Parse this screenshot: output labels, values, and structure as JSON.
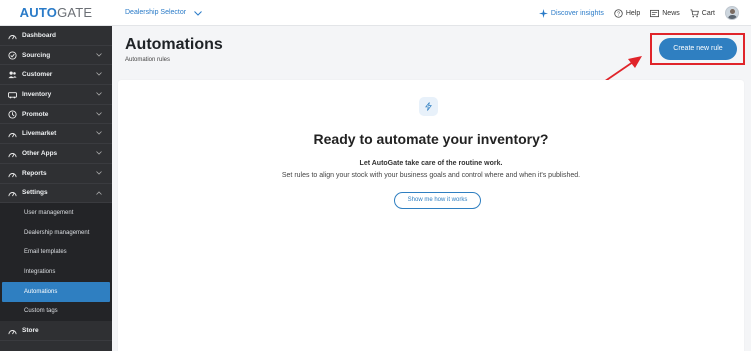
{
  "app": {
    "logo_primary": "AUTO",
    "logo_secondary": "GATE",
    "dealer_selector": "Dealership Selector"
  },
  "topnav": {
    "discover": "Discover insights",
    "help": "Help",
    "news": "News",
    "cart": "Cart"
  },
  "sidebar": {
    "items": [
      {
        "label": "Dashboard",
        "icon": "dashboard-icon"
      },
      {
        "label": "Sourcing",
        "icon": "sourcing-icon"
      },
      {
        "label": "Customer",
        "icon": "customer-icon"
      },
      {
        "label": "Inventory",
        "icon": "inventory-icon"
      },
      {
        "label": "Promote",
        "icon": "promote-icon"
      },
      {
        "label": "Livemarket",
        "icon": "livemarket-icon"
      },
      {
        "label": "Other Apps",
        "icon": "apps-icon"
      },
      {
        "label": "Reports",
        "icon": "reports-icon"
      },
      {
        "label": "Settings",
        "icon": "settings-icon"
      }
    ],
    "settings_sub": [
      "User management",
      "Dealership management",
      "Email templates",
      "Integrations",
      "Automations",
      "Custom tags"
    ],
    "store": "Store"
  },
  "page": {
    "title": "Automations",
    "subtitle": "Automation rules",
    "create_button": "Create new rule"
  },
  "empty_state": {
    "title": "Ready to automate your inventory?",
    "lead": "Let AutoGate take care of the routine work.",
    "description": "Set rules to align your stock with your business goals and control where and when it's published.",
    "button": "Show me how it works"
  },
  "colors": {
    "accent": "#2f7fc1",
    "sidebar_bg": "#2f3033",
    "highlight": "#e0242a"
  }
}
